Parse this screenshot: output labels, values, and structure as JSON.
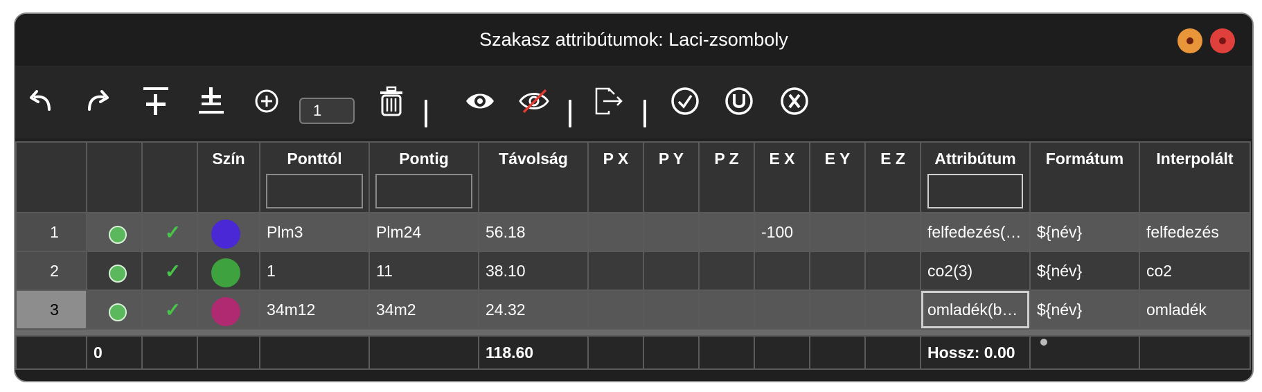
{
  "window": {
    "title": "Szakasz attribútumok: Laci-zsomboly",
    "close_color": "#e0403c",
    "minimize_color": "#e9953a"
  },
  "toolbar": {
    "undo_icon": "undo-icon",
    "redo_icon": "redo-icon",
    "count_value": "1"
  },
  "columns": [
    "",
    "",
    "",
    "Szín",
    "Ponttól",
    "Pontig",
    "Távolság",
    "P X",
    "P Y",
    "P Z",
    "E X",
    "E Y",
    "E Z",
    "Attribútum",
    "Formátum",
    "Interpolált"
  ],
  "rows": [
    {
      "num": "1",
      "color": "#4a28d6",
      "from": "Plm3",
      "to": "Plm24",
      "dist": "56.18",
      "px": "",
      "py": "",
      "pz": "",
      "ex": "-100",
      "ey": "",
      "ez": "",
      "attr": "felfedezés(…",
      "format": "${név}",
      "interp": "felfedezés"
    },
    {
      "num": "2",
      "color": "#3ea33e",
      "from": "1",
      "to": "11",
      "dist": "38.10",
      "px": "",
      "py": "",
      "pz": "",
      "ex": "",
      "ey": "",
      "ez": "",
      "attr": "co2(3)",
      "format": "${név}",
      "interp": "co2"
    },
    {
      "num": "3",
      "color": "#b02a72",
      "from": "34m12",
      "to": "34m2",
      "dist": "24.32",
      "px": "",
      "py": "",
      "pz": "",
      "ex": "",
      "ey": "",
      "ez": "",
      "attr": "omladék(b…",
      "format": "${név}",
      "interp": "omladék"
    }
  ],
  "footer": {
    "count": "0",
    "total_distance": "118.60",
    "length": "Hossz: 0.00"
  }
}
